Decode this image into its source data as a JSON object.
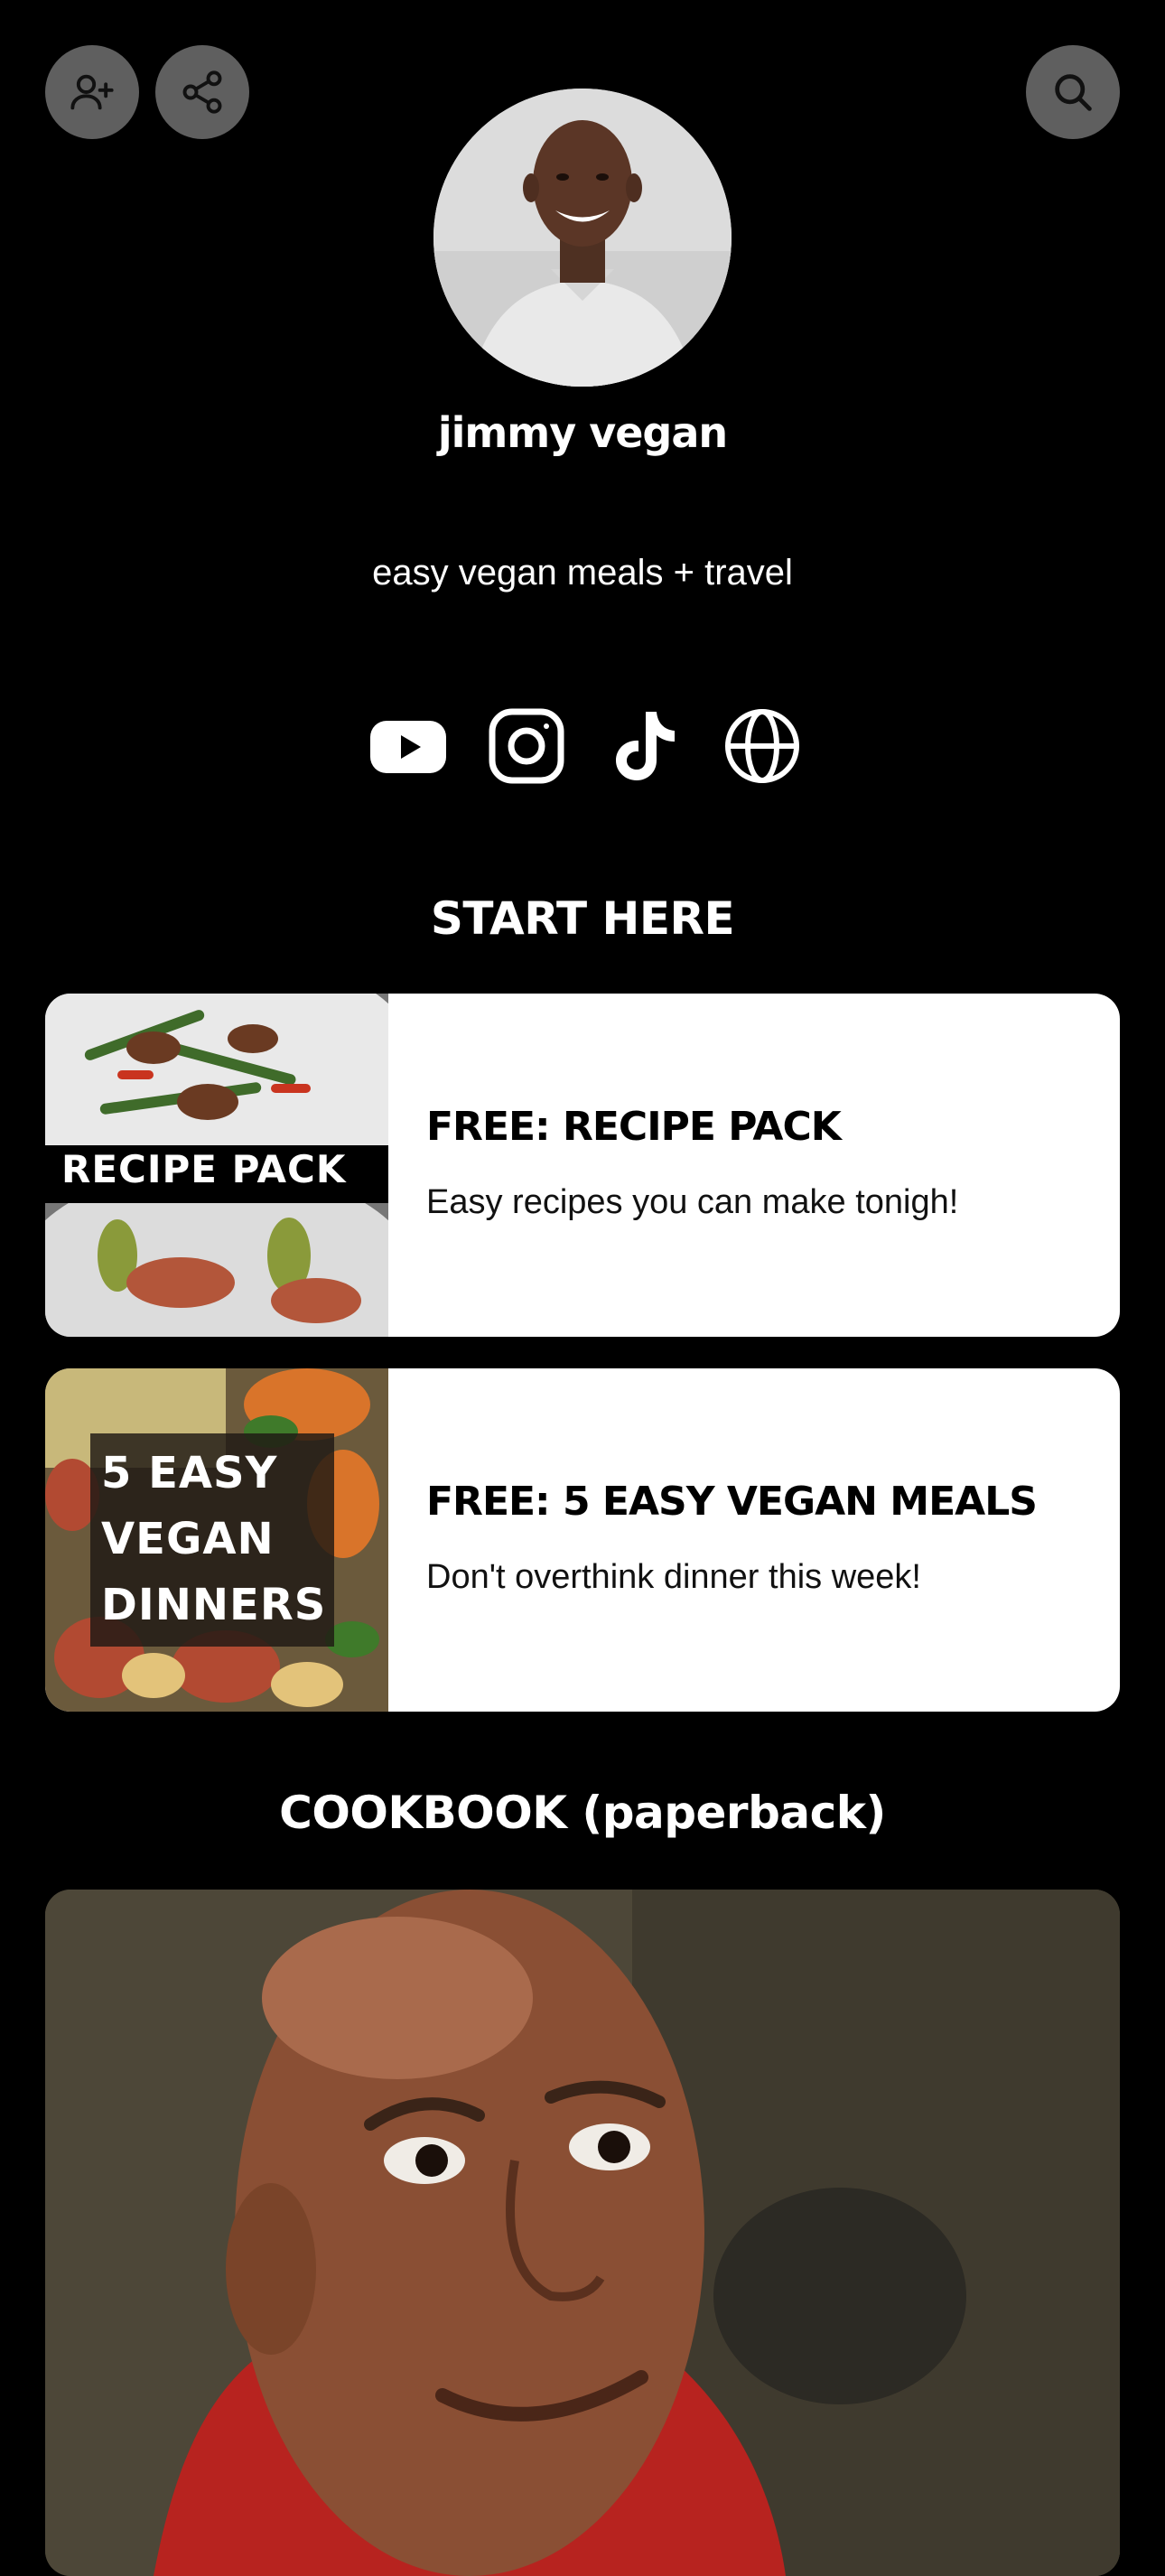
{
  "top_bar": {
    "add_contact_icon": "person-plus-icon",
    "share_icon": "share-icon",
    "search_icon": "search-icon"
  },
  "profile": {
    "name": "jimmy vegan",
    "bio": "easy vegan meals + travel"
  },
  "socials": [
    {
      "icon": "youtube-icon"
    },
    {
      "icon": "instagram-icon"
    },
    {
      "icon": "tiktok-icon"
    },
    {
      "icon": "globe-icon"
    }
  ],
  "sections": {
    "start_here": "START HERE",
    "cookbook": "COOKBOOK (paperback)"
  },
  "links": [
    {
      "thumb_label": "RECIPE PACK",
      "title": "FREE: RECIPE PACK",
      "subtitle": "Easy recipes you can make tonigh!"
    },
    {
      "thumb_label_lines": [
        "5 EASY",
        "VEGAN",
        "DINNERS"
      ],
      "title": "FREE: 5 EASY VEGAN MEALS",
      "subtitle": "Don't overthink dinner this week!"
    }
  ],
  "colors": {
    "background": "#000000",
    "card": "#ffffff",
    "button": "#5f5f5f"
  }
}
